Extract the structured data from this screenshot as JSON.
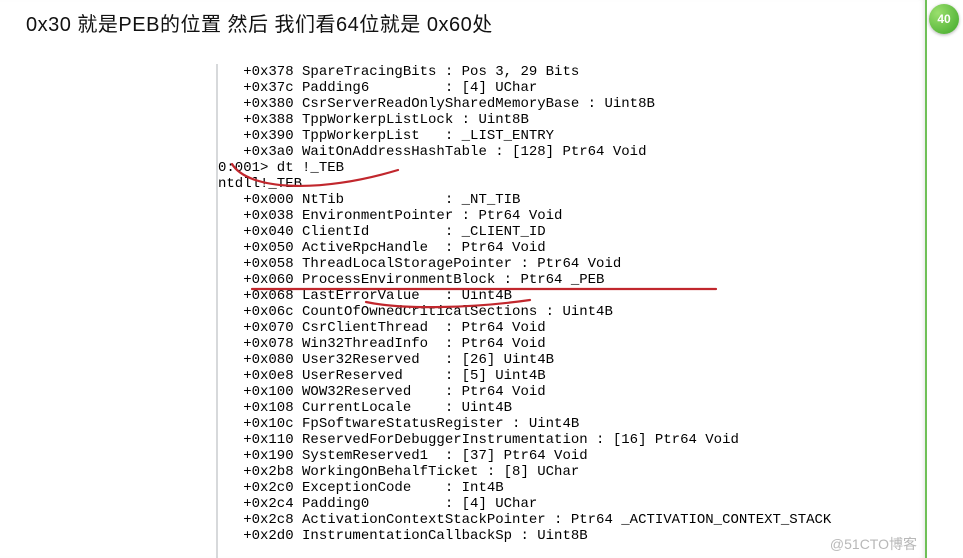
{
  "caption": "0x30 就是PEB的位置  然后  我们看64位就是  0x60处",
  "badge": "40",
  "watermark": "@51CTO博客",
  "console": {
    "pre_lines": [
      "   +0x378 SpareTracingBits : Pos 3, 29 Bits",
      "   +0x37c Padding6         : [4] UChar",
      "   +0x380 CsrServerReadOnlySharedMemoryBase : Uint8B",
      "   +0x388 TppWorkerpListLock : Uint8B",
      "   +0x390 TppWorkerpList   : _LIST_ENTRY",
      "   +0x3a0 WaitOnAddressHashTable : [128] Ptr64 Void"
    ],
    "command_prompt": "0:001> ",
    "command": "dt !_TEB",
    "module_line": "ntdll!_TEB",
    "struct_lines": [
      "   +0x000 NtTib            : _NT_TIB",
      "   +0x038 EnvironmentPointer : Ptr64 Void",
      "   +0x040 ClientId         : _CLIENT_ID",
      "   +0x050 ActiveRpcHandle  : Ptr64 Void",
      "   +0x058 ThreadLocalStoragePointer : Ptr64 Void",
      "   +0x060 ProcessEnvironmentBlock : Ptr64 _PEB",
      "   +0x068 LastErrorValue   : Uint4B",
      "   +0x06c CountOfOwnedCriticalSections : Uint4B",
      "   +0x070 CsrClientThread  : Ptr64 Void",
      "   +0x078 Win32ThreadInfo  : Ptr64 Void",
      "   +0x080 User32Reserved   : [26] Uint4B",
      "   +0x0e8 UserReserved     : [5] Uint4B",
      "   +0x100 WOW32Reserved    : Ptr64 Void",
      "   +0x108 CurrentLocale    : Uint4B",
      "   +0x10c FpSoftwareStatusRegister : Uint4B",
      "   +0x110 ReservedForDebuggerInstrumentation : [16] Ptr64 Void",
      "   +0x190 SystemReserved1  : [37] Ptr64 Void",
      "   +0x2b8 WorkingOnBehalfTicket : [8] UChar",
      "   +0x2c0 ExceptionCode    : Int4B",
      "   +0x2c4 Padding0         : [4] UChar",
      "   +0x2c8 ActivationContextStackPointer : Ptr64 _ACTIVATION_CONTEXT_STACK",
      "   +0x2d0 InstrumentationCallbackSp : Uint8B"
    ]
  }
}
